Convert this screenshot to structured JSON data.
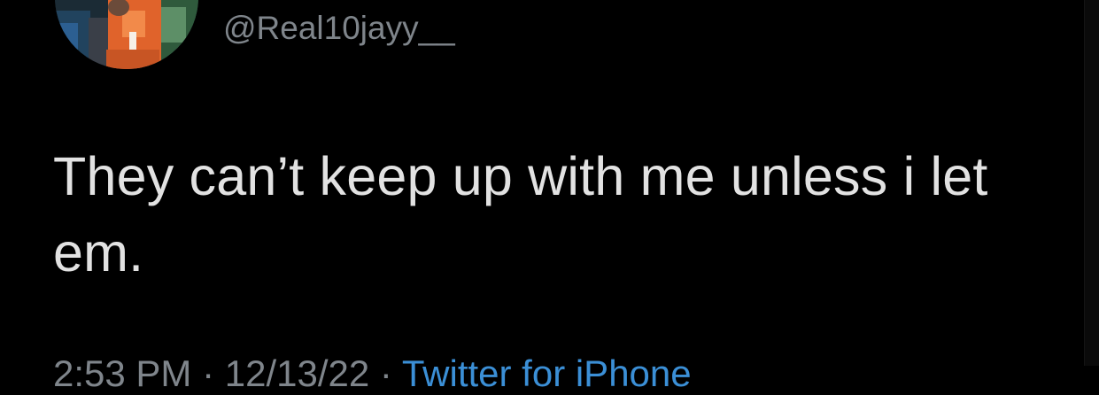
{
  "tweet": {
    "handle": "@Real10jayy__",
    "text": "They can’t keep up with me unless i let em.",
    "timestamp": "2:53 PM · 12/13/22 ·",
    "source": "Twitter for iPhone"
  },
  "colors": {
    "background": "#000000",
    "text": "#e2e2e2",
    "secondary_text": "#7f858b",
    "link": "#3b8fd6"
  }
}
